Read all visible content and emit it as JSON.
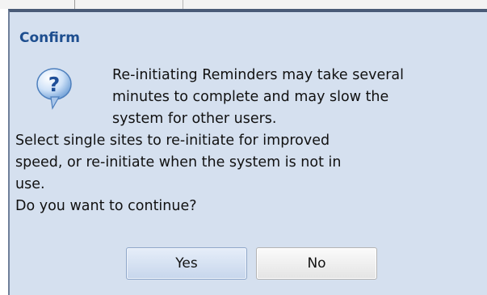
{
  "dialog": {
    "title": "Confirm",
    "icon": "question-icon",
    "message_indented_lines": [
      "Re-initiating Reminders may take several",
      "minutes to complete and may slow the",
      "system for other users."
    ],
    "message_body_lines": [
      "Select single sites to re-initiate for improved",
      "speed, or re-initiate when the system is not in",
      "use.",
      "Do you want to continue?"
    ],
    "buttons": {
      "yes_label": "Yes",
      "no_label": "No"
    }
  },
  "colors": {
    "dialog_background": "#d5e0ef",
    "title_color": "#1d4e8f",
    "frame_border": "#4a5b77"
  }
}
